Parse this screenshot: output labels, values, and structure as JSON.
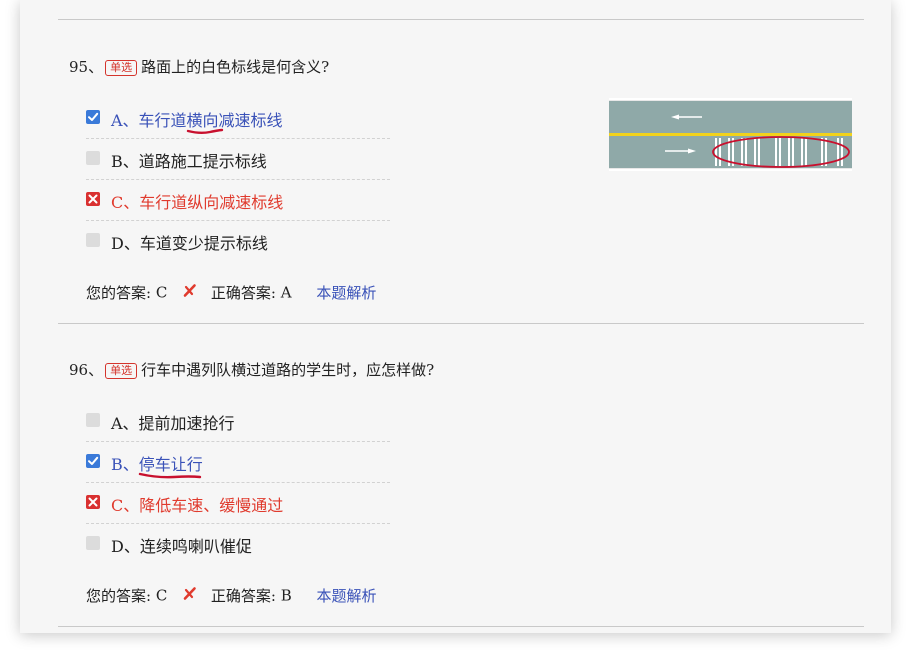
{
  "questions": [
    {
      "number": "95、",
      "tag": "单选",
      "text": "路面上的白色标线是何含义?",
      "options": [
        {
          "label": "A、车行道横向减速标线",
          "state": "correct-choice"
        },
        {
          "label": "B、道路施工提示标线",
          "state": "none"
        },
        {
          "label": "C、车行道纵向减速标线",
          "state": "wrong-choice"
        },
        {
          "label": "D、车道变少提示标线",
          "state": "none"
        }
      ],
      "your_answer_label": "您的答案:",
      "your_answer": "C",
      "correct_answer_label": "正确答案:",
      "correct_answer": "A",
      "analysis_link": "本题解析"
    },
    {
      "number": "96、",
      "tag": "单选",
      "text": "行车中遇列队横过道路的学生时，应怎样做?",
      "options": [
        {
          "label": "A、提前加速抢行",
          "state": "none"
        },
        {
          "label": "B、停车让行",
          "state": "correct-choice"
        },
        {
          "label": "C、降低车速、缓慢通过",
          "state": "wrong-choice"
        },
        {
          "label": "D、连续鸣喇叭催促",
          "state": "none"
        }
      ],
      "your_answer_label": "您的答案:",
      "your_answer": "C",
      "correct_answer_label": "正确答案:",
      "correct_answer": "B",
      "analysis_link": "本题解析"
    }
  ],
  "colors": {
    "correct_blue": "#3a52b8",
    "wrong_red": "#e03b2e",
    "checkbox_blue": "#3a7ad9",
    "annotation_red": "#c8102e"
  },
  "icons": {
    "checked": "checkbox-checked-icon",
    "wrong": "checkbox-wrong-icon",
    "unchecked": "checkbox-empty-icon",
    "mismatch": "red-cross-icon"
  }
}
